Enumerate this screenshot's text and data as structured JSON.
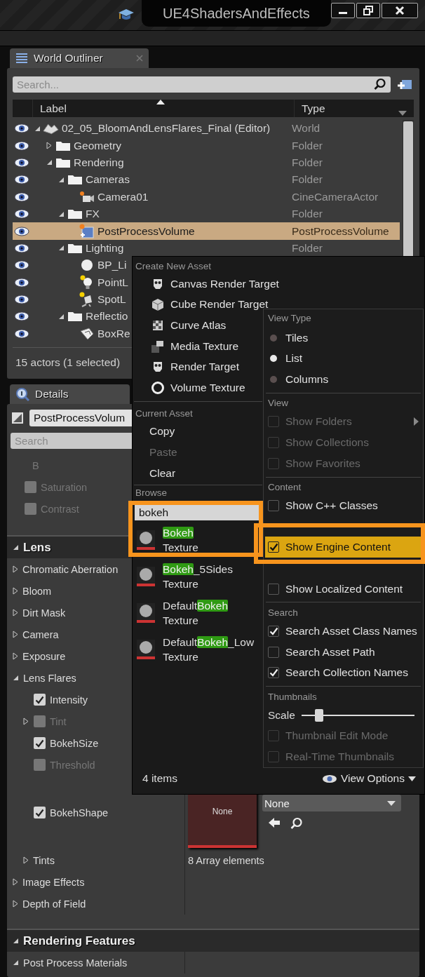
{
  "window": {
    "title": "UE4ShadersAndEffects"
  },
  "outliner": {
    "tab": "World Outliner",
    "search_placeholder": "Search...",
    "columns": [
      "Label",
      "Type"
    ],
    "rows": [
      {
        "label": "02_05_BloomAndLensFlares_Final (Editor)",
        "type": "World",
        "kind": "world",
        "expanded": true,
        "selected": false,
        "children": [
          {
            "label": "Geometry",
            "type": "Folder",
            "kind": "folder",
            "expanded": false,
            "selected": false
          },
          {
            "label": "Rendering",
            "type": "Folder",
            "kind": "folder",
            "expanded": true,
            "selected": false,
            "children": [
              {
                "label": "Cameras",
                "type": "Folder",
                "kind": "folder",
                "expanded": true,
                "selected": false,
                "children": [
                  {
                    "label": "Camera01",
                    "type": "CineCameraActor",
                    "kind": "camera",
                    "selected": false
                  }
                ]
              },
              {
                "label": "FX",
                "type": "Folder",
                "kind": "folder",
                "expanded": true,
                "selected": false,
                "children": [
                  {
                    "label": "PostProcessVolume",
                    "type": "PostProcessVolume",
                    "kind": "volume",
                    "selected": true
                  }
                ]
              },
              {
                "label": "Lighting",
                "type": "Folder",
                "kind": "folder",
                "expanded": true,
                "selected": false,
                "children": [
                  {
                    "label": "BP_Li",
                    "kind": "sphere",
                    "selected": false
                  },
                  {
                    "label": "PointL",
                    "kind": "pointlight",
                    "selected": false
                  },
                  {
                    "label": "SpotL",
                    "kind": "spotlight",
                    "selected": false
                  }
                ]
              },
              {
                "label": "Reflectio",
                "kind": "folder",
                "expanded": true,
                "selected": false,
                "children": [
                  {
                    "label": "BoxRe",
                    "kind": "reflection",
                    "selected": false
                  }
                ]
              }
            ]
          }
        ]
      }
    ],
    "status": "15 actors (1 selected)"
  },
  "details": {
    "tab": "Details",
    "object_name": "PostProcessVolum",
    "search_placeholder": "Search",
    "rows": [
      {
        "kind": "label",
        "label": "B"
      },
      {
        "kind": "check",
        "label": "Saturation",
        "checked": false,
        "disabled": true
      },
      {
        "kind": "check",
        "label": "Contrast",
        "checked": false,
        "disabled": true
      },
      {
        "kind": "section",
        "label": "Lens",
        "expanded": true,
        "children": [
          {
            "kind": "group",
            "label": "Chromatic Aberration",
            "expanded": false
          },
          {
            "kind": "group",
            "label": "Bloom",
            "expanded": false
          },
          {
            "kind": "group",
            "label": "Dirt Mask",
            "expanded": false
          },
          {
            "kind": "group",
            "label": "Camera",
            "expanded": false
          },
          {
            "kind": "group",
            "label": "Exposure",
            "expanded": false
          },
          {
            "kind": "group",
            "label": "Lens Flares",
            "expanded": true,
            "children": [
              {
                "kind": "check",
                "label": "Intensity",
                "checked": true,
                "disabled": false
              },
              {
                "kind": "check",
                "label": "Tint",
                "checked": false,
                "disabled": true,
                "expandable": true
              },
              {
                "kind": "check",
                "label": "BokehSize",
                "checked": true,
                "disabled": false
              },
              {
                "kind": "check",
                "label": "Threshold",
                "checked": false,
                "disabled": true
              },
              {
                "kind": "asset",
                "label": "BokehShape",
                "checked": true,
                "thumbnail": "None",
                "value": "None"
              },
              {
                "kind": "array",
                "label": "Tints",
                "expanded": false,
                "value": "8 Array elements"
              }
            ]
          },
          {
            "kind": "group",
            "label": "Image Effects",
            "expanded": false
          },
          {
            "kind": "group",
            "label": "Depth of Field",
            "expanded": false
          }
        ]
      },
      {
        "kind": "section",
        "label": "Rendering Features",
        "expanded": true,
        "children": [
          {
            "kind": "group",
            "label": "Post Process Materials",
            "expanded": true
          }
        ]
      }
    ]
  },
  "asset_picker": {
    "create_header": "Create New Asset",
    "create_items": [
      {
        "label": "Canvas Render Target",
        "kind": "target"
      },
      {
        "label": "Cube Render Target",
        "kind": "cube"
      },
      {
        "label": "Curve Atlas",
        "kind": "atlas"
      },
      {
        "label": "Media Texture",
        "kind": "media"
      },
      {
        "label": "Render Target",
        "kind": "target"
      },
      {
        "label": "Volume Texture",
        "kind": "volume"
      }
    ],
    "current_header": "Current Asset",
    "current_items": [
      {
        "label": "Copy",
        "disabled": false
      },
      {
        "label": "Paste",
        "disabled": true
      },
      {
        "label": "Clear",
        "disabled": false
      }
    ],
    "browse_header": "Browse",
    "search": "bokeh",
    "results": [
      {
        "match": "Bokeh",
        "type": "Texture"
      },
      {
        "match": "Bokeh",
        "suffix": "_5Sides",
        "type": "Texture"
      },
      {
        "prefix": "Default",
        "match": "Bokeh",
        "type": "Texture"
      },
      {
        "prefix": "Default",
        "match": "Bokeh",
        "suffix": "_Low",
        "type": "Texture"
      }
    ],
    "count": "4 items",
    "view_options": "View Options"
  },
  "view_menu": {
    "sections": [
      {
        "title": "View Type",
        "items": [
          {
            "kind": "radio",
            "label": "Tiles",
            "selected": false
          },
          {
            "kind": "radio",
            "label": "List",
            "selected": true
          },
          {
            "kind": "radio",
            "label": "Columns",
            "selected": false
          }
        ]
      },
      {
        "title": "View",
        "items": [
          {
            "kind": "check",
            "label": "Show Folders",
            "checked": false,
            "disabled": true,
            "submenu": true
          },
          {
            "kind": "check",
            "label": "Show Collections",
            "checked": false,
            "disabled": true
          },
          {
            "kind": "check",
            "label": "Show Favorites",
            "checked": false,
            "disabled": true
          }
        ]
      },
      {
        "title": "Content",
        "items": [
          {
            "kind": "check",
            "label": "Show C++ Classes",
            "checked": false,
            "disabled": false,
            "highlighted": false
          },
          {
            "kind": "check",
            "label": "Show Engine Content",
            "checked": true,
            "disabled": false,
            "highlighted": true
          },
          {
            "kind": "check",
            "label": "Show Localized Content",
            "checked": false,
            "disabled": false,
            "highlighted": false
          }
        ]
      },
      {
        "title": "Search",
        "items": [
          {
            "kind": "check",
            "label": "Search Asset Class Names",
            "checked": true,
            "disabled": false
          },
          {
            "kind": "check",
            "label": "Search Asset Path",
            "checked": false,
            "disabled": false
          },
          {
            "kind": "check",
            "label": "Search Collection Names",
            "checked": true,
            "disabled": false
          }
        ]
      },
      {
        "title": "Thumbnails",
        "items": [
          {
            "kind": "slider",
            "label": "Scale",
            "level": 0.12
          },
          {
            "kind": "check",
            "label": "Thumbnail Edit Mode",
            "checked": false,
            "disabled": true
          },
          {
            "kind": "check",
            "label": "Real-Time Thumbnails",
            "checked": false,
            "disabled": true
          }
        ]
      }
    ]
  }
}
